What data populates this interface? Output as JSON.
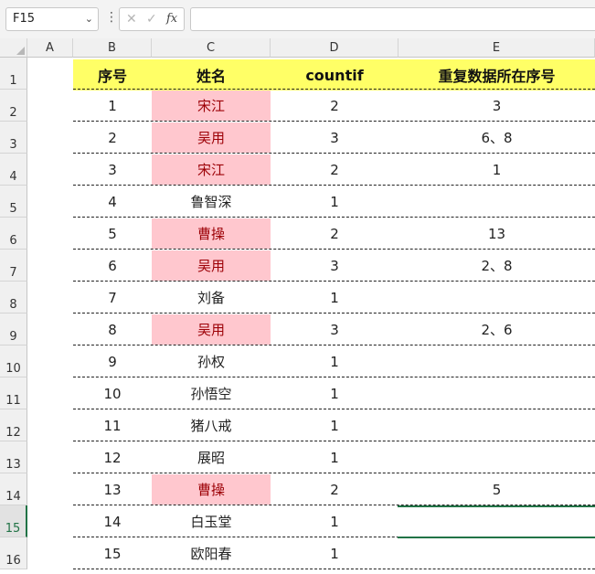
{
  "formula_bar": {
    "name_box": "F15",
    "cancel_icon": "✕",
    "enter_icon": "✓",
    "fx_label": "fx",
    "formula": ""
  },
  "columns": [
    "A",
    "B",
    "C",
    "D",
    "E"
  ],
  "rows": [
    "1",
    "2",
    "3",
    "4",
    "5",
    "6",
    "7",
    "8",
    "9",
    "10",
    "11",
    "12",
    "13",
    "14",
    "15",
    "16"
  ],
  "selected_row": "15",
  "table": {
    "headers": [
      "序号",
      "姓名",
      "countif",
      "重复数据所在序号"
    ],
    "records": [
      {
        "no": "1",
        "name": "宋江",
        "count": "2",
        "dup": "3",
        "highlight": true
      },
      {
        "no": "2",
        "name": "吴用",
        "count": "3",
        "dup": "6、8",
        "highlight": true
      },
      {
        "no": "3",
        "name": "宋江",
        "count": "2",
        "dup": "1",
        "highlight": true
      },
      {
        "no": "4",
        "name": "鲁智深",
        "count": "1",
        "dup": "",
        "highlight": false
      },
      {
        "no": "5",
        "name": "曹操",
        "count": "2",
        "dup": "13",
        "highlight": true
      },
      {
        "no": "6",
        "name": "吴用",
        "count": "3",
        "dup": "2、8",
        "highlight": true
      },
      {
        "no": "7",
        "name": "刘备",
        "count": "1",
        "dup": "",
        "highlight": false
      },
      {
        "no": "8",
        "name": "吴用",
        "count": "3",
        "dup": "2、6",
        "highlight": true
      },
      {
        "no": "9",
        "name": "孙权",
        "count": "1",
        "dup": "",
        "highlight": false
      },
      {
        "no": "10",
        "name": "孙悟空",
        "count": "1",
        "dup": "",
        "highlight": false
      },
      {
        "no": "11",
        "name": "猪八戒",
        "count": "1",
        "dup": "",
        "highlight": false
      },
      {
        "no": "12",
        "name": "展昭",
        "count": "1",
        "dup": "",
        "highlight": false
      },
      {
        "no": "13",
        "name": "曹操",
        "count": "2",
        "dup": "5",
        "highlight": true
      },
      {
        "no": "14",
        "name": "白玉堂",
        "count": "1",
        "dup": "",
        "highlight": false
      },
      {
        "no": "15",
        "name": "欧阳春",
        "count": "1",
        "dup": "",
        "highlight": false
      }
    ]
  },
  "colors": {
    "header_fill": "#ffff66",
    "duplicate_fill": "#ffc7ce",
    "duplicate_text": "#9c0006",
    "selection": "#217346"
  }
}
